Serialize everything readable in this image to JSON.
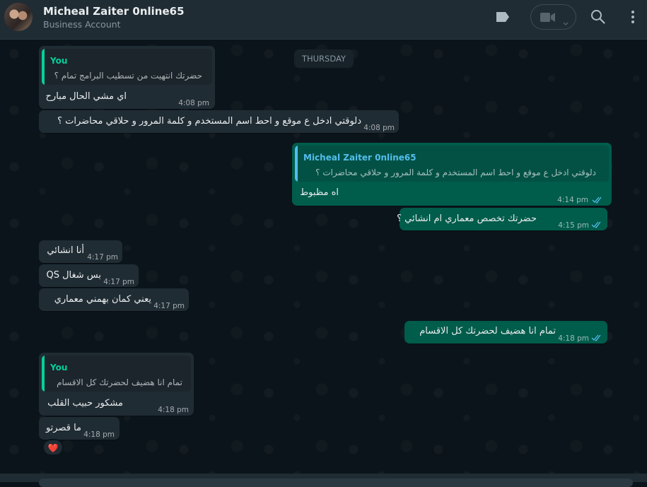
{
  "header": {
    "contact_name": "Micheal Zaiter 0nline65",
    "contact_subtitle": "Business Account",
    "icons": [
      "label-icon",
      "video-call-icon",
      "chevron-down-icon",
      "search-icon",
      "menu-icon"
    ]
  },
  "date_chip": "THURSDAY",
  "messages": [
    {
      "direction": "in",
      "quote_author": "You",
      "quote_text": "حضرتك انتهيت من تسطيب البرامج تمام ؟",
      "text": "اي مشي الحال مبارح",
      "time": "4:08 pm"
    },
    {
      "direction": "in",
      "text": "دلوقتي ادخل ع موقع و احط اسم المستخدم و كلمة المرور و حلاقي محاضرات ؟",
      "time": "4:08 pm"
    },
    {
      "direction": "out",
      "quote_author": "Micheal Zaiter 0nline65",
      "quote_text": "دلوقتي ادخل ع موقع و احط اسم المستخدم و كلمة المرور و حلاقي محاضرات ؟",
      "text": "اه مظبوط",
      "time": "4:14 pm",
      "status": "read"
    },
    {
      "direction": "out",
      "text": "حضرتك تخصص معماري ام انشائي ؟",
      "time": "4:15 pm",
      "status": "read"
    },
    {
      "direction": "in",
      "text": "أنا انشائي",
      "time": "4:17 pm"
    },
    {
      "direction": "in",
      "text": "بس شغال QS",
      "time": "4:17 pm"
    },
    {
      "direction": "in",
      "text": "يعني كمان بهمني معماري",
      "time": "4:17 pm"
    },
    {
      "direction": "out",
      "text": "تمام انا هضيف لحضرتك كل الاقسام",
      "time": "4:18 pm",
      "status": "read"
    },
    {
      "direction": "in",
      "quote_author": "You",
      "quote_text": "تمام انا هضيف لحضرتك كل الاقسام",
      "text": "مشكور حبيب القلب",
      "time": "4:18 pm"
    },
    {
      "direction": "in",
      "text": "ما قصرتو",
      "time": "4:18 pm",
      "reaction": "❤️"
    }
  ],
  "colors": {
    "chat_bg": "#0b141a",
    "header_bg": "#202c33",
    "incoming_bubble": "#202c33",
    "outgoing_bubble": "#005c4b",
    "quote_you_accent": "#06cf9c",
    "quote_contact_accent": "#53bdeb",
    "read_ticks": "#53bdeb"
  }
}
